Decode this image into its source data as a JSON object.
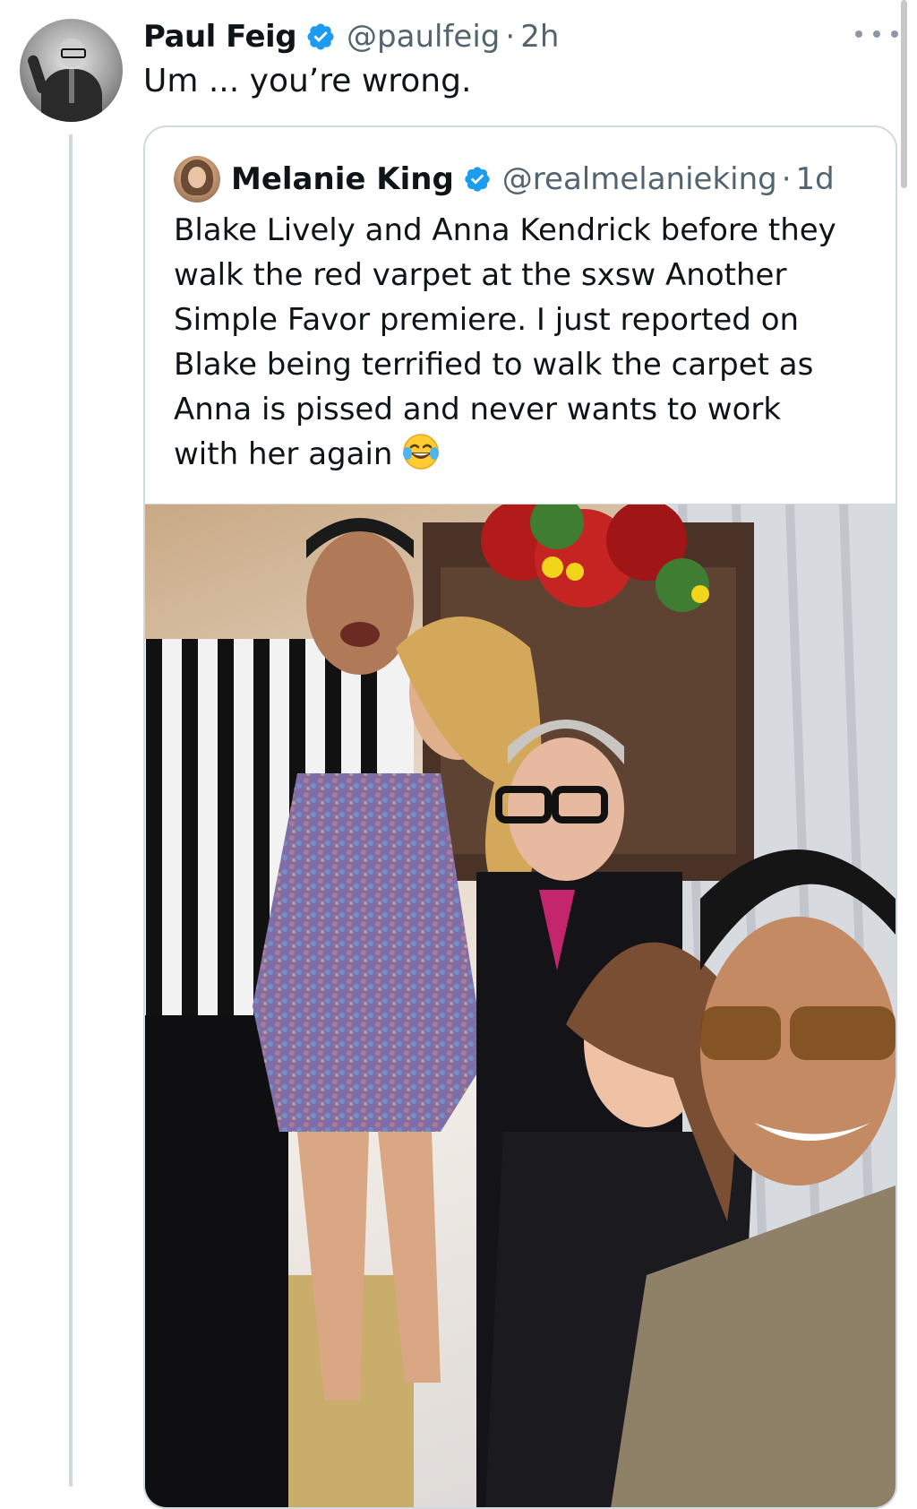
{
  "tweet": {
    "author_name": "Paul Feig",
    "handle": "@paulfeig",
    "separator": "·",
    "time": "2h",
    "text": "Um ... you’re wrong."
  },
  "quoted": {
    "author_name": "Melanie King",
    "handle": "@realmelanieking",
    "separator": "·",
    "time": "1d",
    "text_lines": [
      "Blake Lively and Anna Kendrick before they",
      "walk the red varpet at the sxsw Another",
      "Simple Favor premiere. I just reported on",
      "Blake being terrified to walk the carpet as",
      "Anna is pissed and never wants to work",
      "with her again"
    ],
    "emoji": "face-with-tears-of-joy-icon"
  },
  "icons": {
    "verified": "verified-badge-icon",
    "more": "more-options-icon"
  },
  "colors": {
    "verified_blue": "#1d9bf0",
    "secondary_text": "#536471",
    "border": "#cfd9de"
  }
}
